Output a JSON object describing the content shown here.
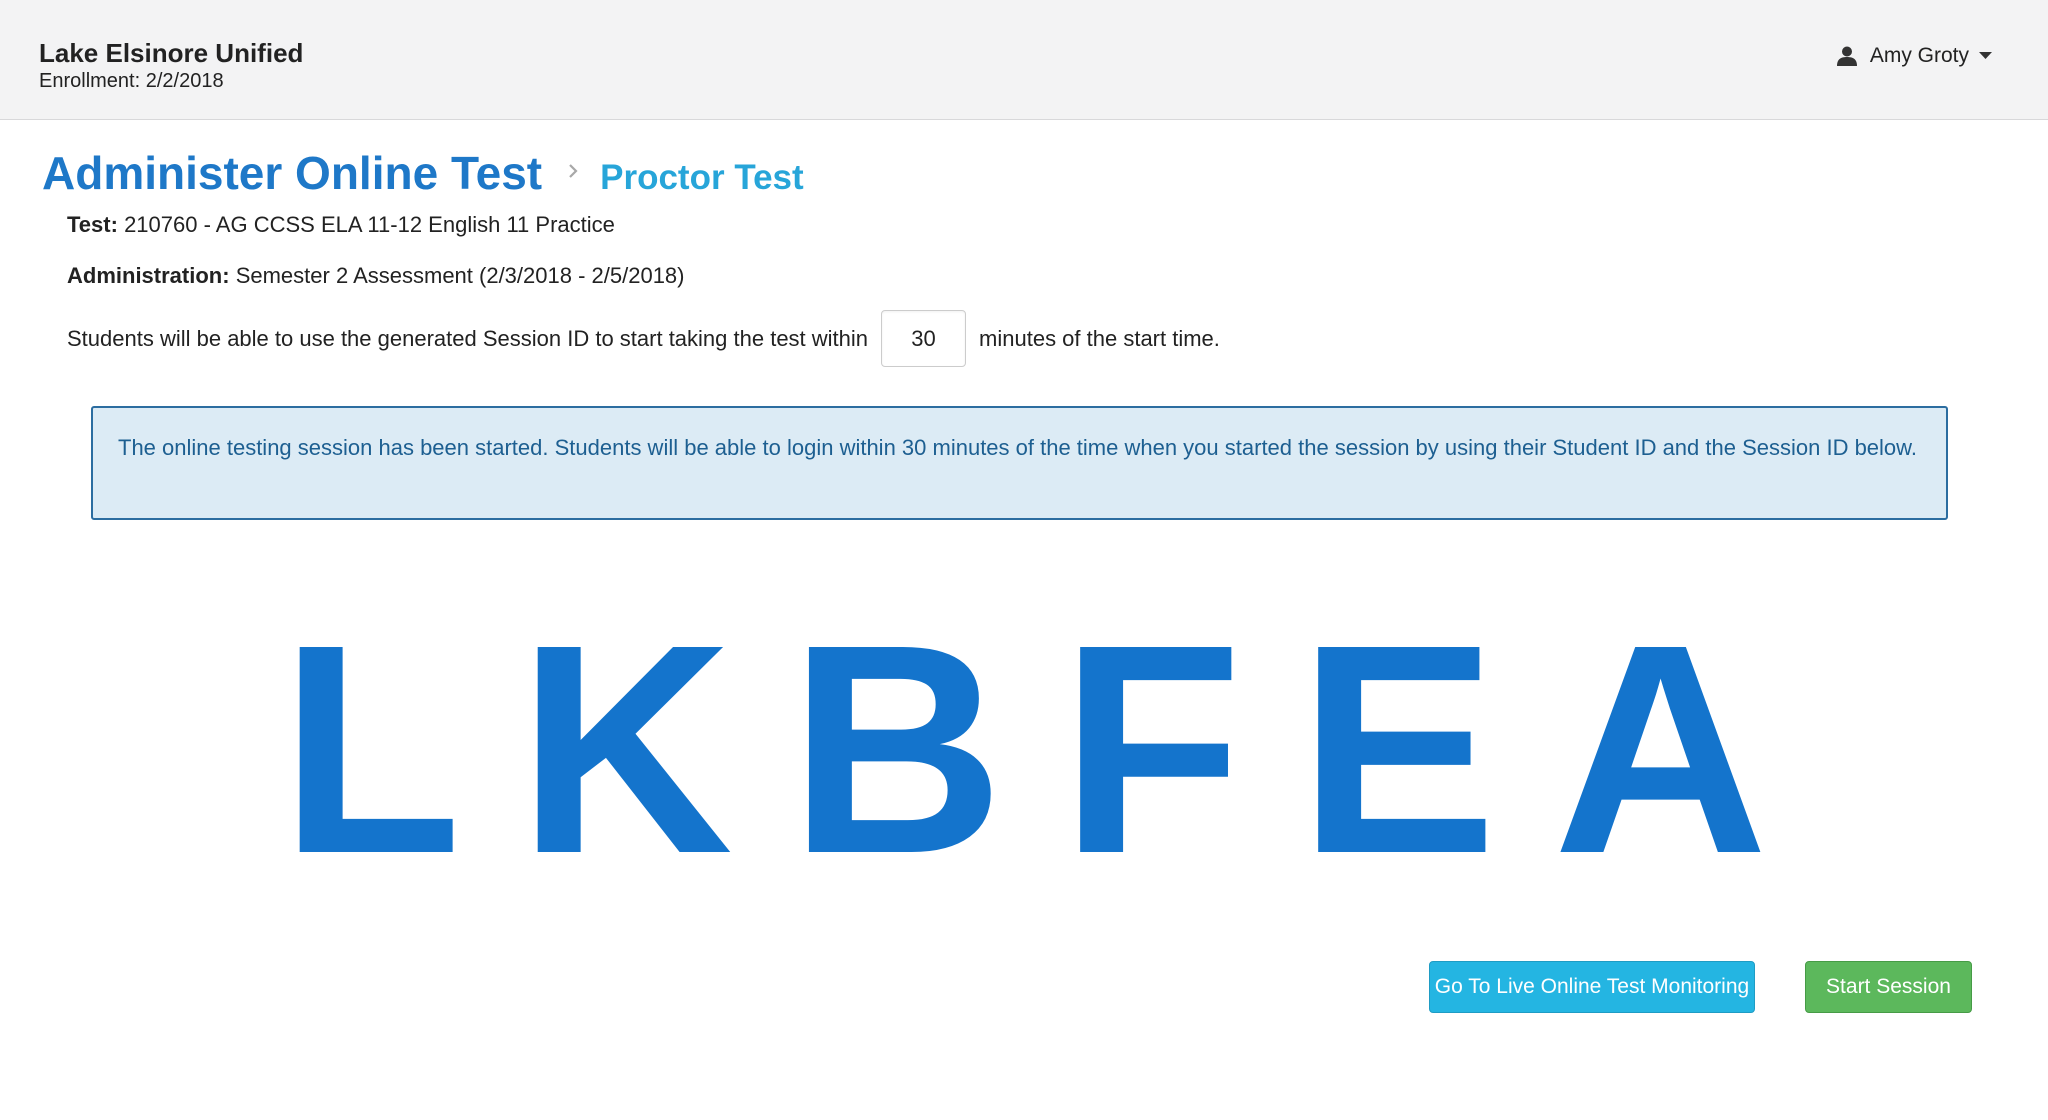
{
  "header": {
    "org_name": "Lake Elsinore Unified",
    "enrollment": "Enrollment: 2/2/2018",
    "user_name": "Amy Groty",
    "user_icon": "user-icon",
    "menu_icon": "caret-down-icon"
  },
  "breadcrumb": {
    "title": "Administer Online Test",
    "separator_icon": "chevron-right-icon",
    "subtitle": "Proctor Test"
  },
  "details": {
    "test_label": "Test:",
    "test_value": "210760 - AG CCSS ELA 11-12 English 11 Practice",
    "admin_label": "Administration:",
    "admin_value": "Semester 2 Assessment (2/3/2018 - 2/5/2018)"
  },
  "timing": {
    "prefix": "Students will be able to use the generated Session ID to start taking the test within",
    "minutes_value": "30",
    "suffix": "minutes of the start time."
  },
  "alert": {
    "message": "The online testing session has been started. Students will be able to login within 30 minutes of the time when you started the session by using their Student ID and the Session ID below."
  },
  "session": {
    "letters": [
      "L",
      "K",
      "B",
      "F",
      "E",
      "A"
    ]
  },
  "actions": {
    "monitor_label": "Go To Live Online Test Monitoring",
    "start_label": "Start Session"
  },
  "colors": {
    "title": "#1e78c8",
    "subtitle": "#27a5d9",
    "session_id": "#1474cc",
    "alert_bg": "#dcebf5",
    "monitor_button": "#24b5e2",
    "start_button": "#5cb85c"
  }
}
